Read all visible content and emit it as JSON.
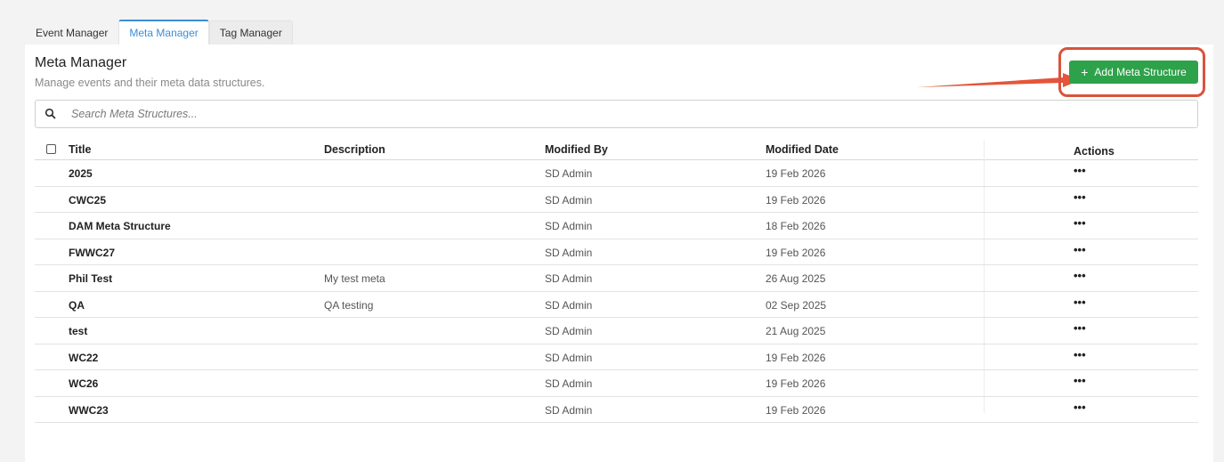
{
  "tabs": [
    {
      "label": "Event Manager",
      "active": false
    },
    {
      "label": "Meta Manager",
      "active": true
    },
    {
      "label": "Tag Manager",
      "active": false
    }
  ],
  "header": {
    "title": "Meta Manager",
    "subtitle": "Manage events and their meta data structures."
  },
  "add_button": {
    "icon": "plus-icon",
    "label": "Add Meta Structure",
    "color": "#2ea24a",
    "highlight_color": "#d9533c"
  },
  "search": {
    "icon": "search-icon",
    "placeholder": "Search Meta Structures...",
    "value": ""
  },
  "table": {
    "columns": {
      "title": "Title",
      "description": "Description",
      "modified_by": "Modified By",
      "modified_date": "Modified Date",
      "actions": "Actions"
    },
    "rows": [
      {
        "title": "2025",
        "description": "",
        "modified_by": "SD Admin",
        "modified_date": "19 Feb 2026",
        "actions": "•••"
      },
      {
        "title": "CWC25",
        "description": "",
        "modified_by": "SD Admin",
        "modified_date": "19 Feb 2026",
        "actions": "•••"
      },
      {
        "title": "DAM Meta Structure",
        "description": "",
        "modified_by": "SD Admin",
        "modified_date": "18 Feb 2026",
        "actions": "•••"
      },
      {
        "title": "FWWC27",
        "description": "",
        "modified_by": "SD Admin",
        "modified_date": "19 Feb 2026",
        "actions": "•••"
      },
      {
        "title": "Phil Test",
        "description": "My test meta",
        "modified_by": "SD Admin",
        "modified_date": "26 Aug 2025",
        "actions": "•••"
      },
      {
        "title": "QA",
        "description": "QA testing",
        "modified_by": "SD Admin",
        "modified_date": "02 Sep 2025",
        "actions": "•••"
      },
      {
        "title": "test",
        "description": "",
        "modified_by": "SD Admin",
        "modified_date": "21 Aug 2025",
        "actions": "•••"
      },
      {
        "title": "WC22",
        "description": "",
        "modified_by": "SD Admin",
        "modified_date": "19 Feb 2026",
        "actions": "•••"
      },
      {
        "title": "WC26",
        "description": "",
        "modified_by": "SD Admin",
        "modified_date": "19 Feb 2026",
        "actions": "•••"
      },
      {
        "title": "WWC23",
        "description": "",
        "modified_by": "SD Admin",
        "modified_date": "19 Feb 2026",
        "actions": "•••"
      }
    ]
  }
}
